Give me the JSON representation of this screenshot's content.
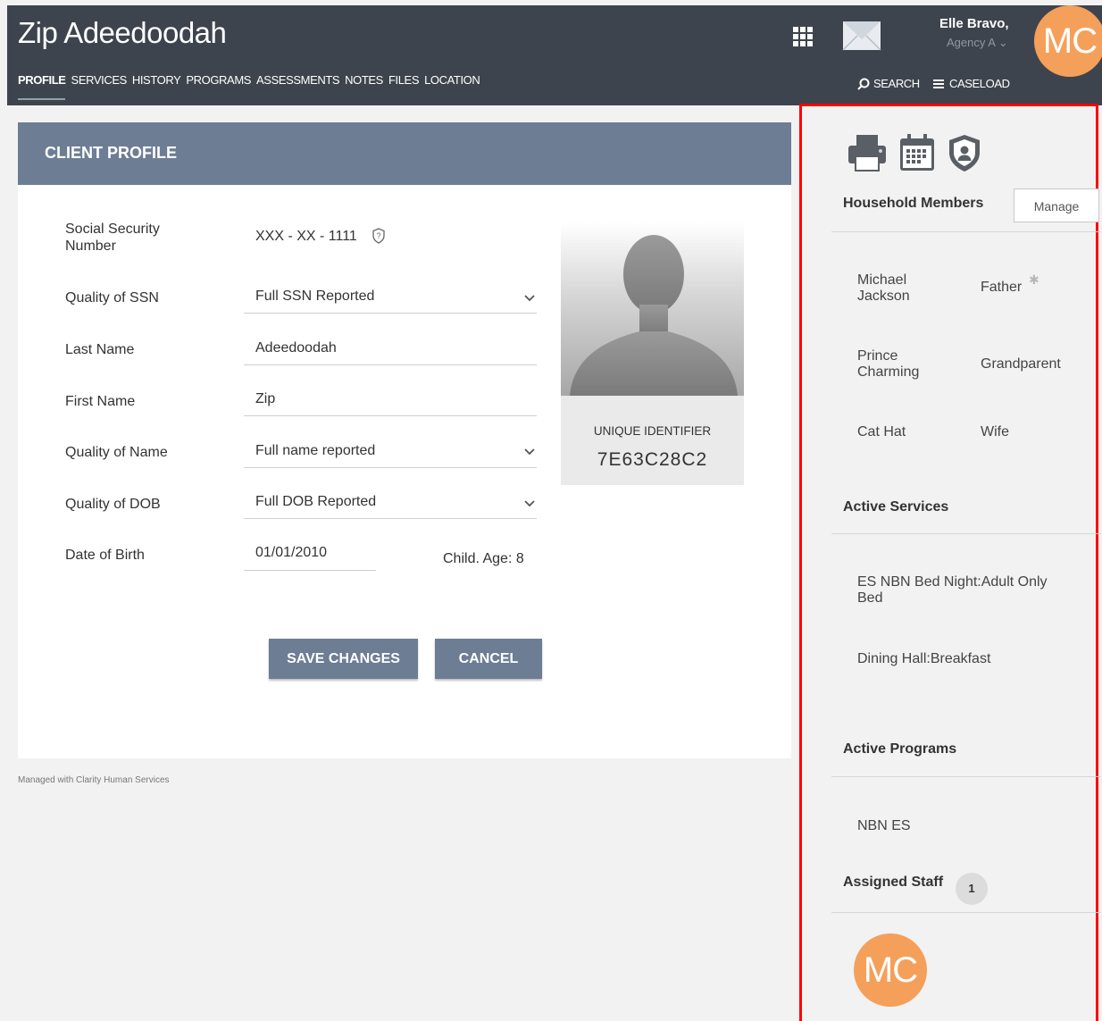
{
  "header": {
    "client_name": "Zip Adeedoodah",
    "nav_tabs": [
      "PROFILE",
      "SERVICES",
      "HISTORY",
      "PROGRAMS",
      "ASSESSMENTS",
      "NOTES",
      "FILES",
      "LOCATION"
    ],
    "user_name": "Elle Bravo,",
    "user_agency": "Agency A",
    "avatar_initials": "MC",
    "search_label": "SEARCH",
    "caseload_label": "CASELOAD"
  },
  "profile": {
    "title": "CLIENT PROFILE",
    "fields": {
      "ssn_label": "Social Security Number",
      "ssn_value": "XXX - XX - 1111",
      "ssn_quality_label": "Quality of SSN",
      "ssn_quality_value": "Full SSN Reported",
      "last_name_label": "Last Name",
      "last_name_value": "Adeedoodah",
      "first_name_label": "First Name",
      "first_name_value": "Zip",
      "name_quality_label": "Quality of Name",
      "name_quality_value": "Full name reported",
      "dob_quality_label": "Quality of DOB",
      "dob_quality_value": "Full DOB Reported",
      "dob_label": "Date of Birth",
      "dob_value": "01/01/2010",
      "age_text": "Child. Age: 8"
    },
    "unique_id_label": "UNIQUE IDENTIFIER",
    "unique_id_value": "7E63C28C2",
    "save_label": "SAVE CHANGES",
    "cancel_label": "CANCEL",
    "footer": "Managed with Clarity Human Services"
  },
  "side": {
    "household_title": "Household Members",
    "manage_label": "Manage",
    "household": [
      {
        "name": "Michael Jackson",
        "relation": "Father"
      },
      {
        "name": "Prince Charming",
        "relation": "Grandparent"
      },
      {
        "name": "Cat Hat",
        "relation": "Wife"
      }
    ],
    "services_title": "Active Services",
    "services": [
      "ES NBN Bed Night:Adult Only Bed",
      "Dining Hall:Breakfast"
    ],
    "programs_title": "Active Programs",
    "programs": [
      "NBN ES"
    ],
    "staff_title": "Assigned Staff",
    "staff_count": "1",
    "staff_initials": "MC"
  },
  "colors": {
    "header_bg": "#3e444d",
    "card_header": "#6d7d93",
    "avatar": "#f4a05a",
    "highlight_border": "#ff0000"
  }
}
